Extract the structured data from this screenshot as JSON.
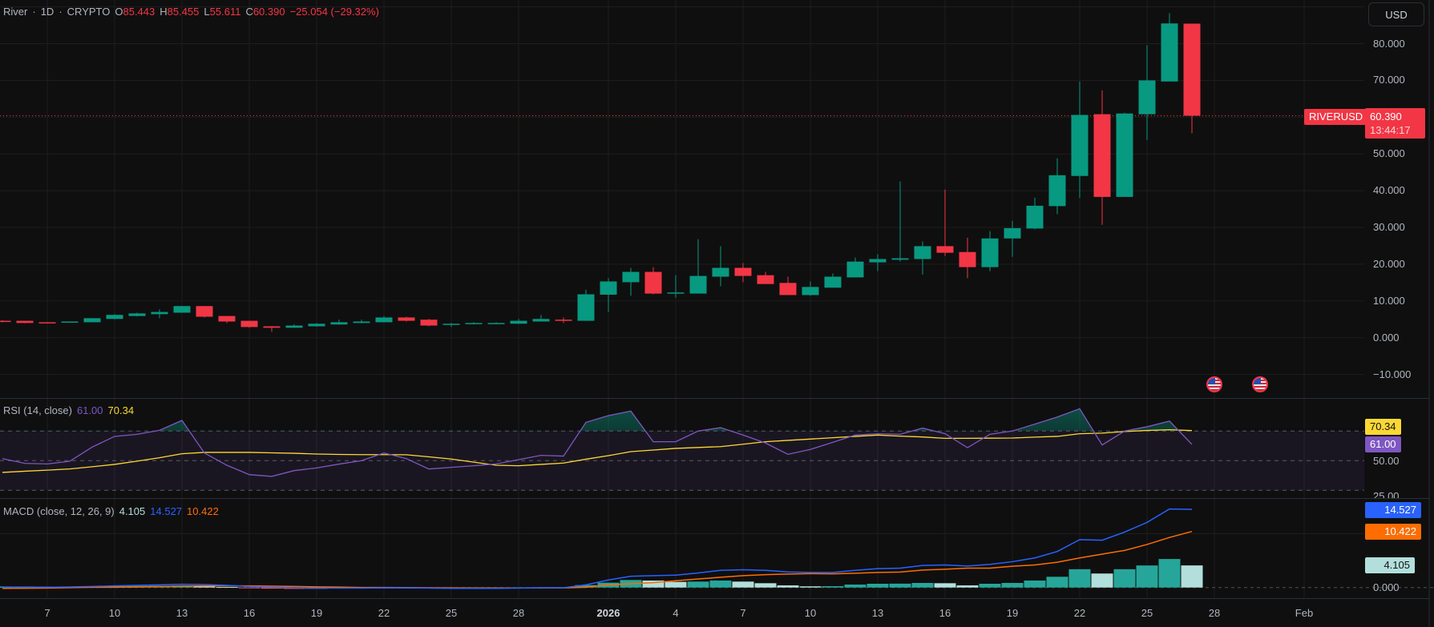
{
  "header": {
    "symbol": "River",
    "interval": "1D",
    "exchange": "CRYPTO",
    "sep": "·",
    "open_label": "O",
    "open": "85.443",
    "high_label": "H",
    "high": "85.455",
    "low_label": "L",
    "low": "55.611",
    "close_label": "C",
    "close": "60.390",
    "change": "−25.054 (−29.32%)"
  },
  "currency_button": "USD",
  "price_axis": [
    "80.000",
    "70.000",
    "50.000",
    "40.000",
    "30.000",
    "20.000",
    "10.000",
    "0.000",
    "−10.000"
  ],
  "last_price": {
    "symbol": "RIVERUSD",
    "price": "60.390",
    "countdown": "13:44:17"
  },
  "rsi": {
    "title": "RSI (14, close)",
    "value": "61.00",
    "ma_value": "70.34",
    "axis": [
      "50.00",
      "25.00"
    ]
  },
  "macd": {
    "title": "MACD (close, 12, 26, 9)",
    "hist_value": "4.105",
    "macd_value": "14.527",
    "signal_value": "10.422",
    "axis": [
      "0.000"
    ]
  },
  "x_axis": [
    "7",
    "10",
    "13",
    "16",
    "19",
    "22",
    "25",
    "28",
    "2026",
    "4",
    "7",
    "10",
    "13",
    "16",
    "19",
    "22",
    "25",
    "28",
    "Feb"
  ],
  "events": [
    "us-flag-event",
    "us-flag-event"
  ],
  "colors": {
    "up": "#089981",
    "down": "#f23645",
    "rsi": "#7e57c2",
    "rsi_ma": "#fdd835",
    "macd": "#2962ff",
    "signal": "#ff6d00",
    "hist_up_strong": "#26a69a",
    "hist_up_weak": "#b2dfdb",
    "hist_down_strong": "#ff5252",
    "hist_down_weak": "#ffcdd2",
    "background": "#0f0f0f"
  },
  "chart_data": {
    "type": "candlestick",
    "first_date": "Dec 5",
    "last_date": "Jan 27",
    "ohlc": [
      [
        4.6,
        4.8,
        4.2,
        4.4
      ],
      [
        4.6,
        4.6,
        3.9,
        4.0
      ],
      [
        4.2,
        4.2,
        4.0,
        4.0
      ],
      [
        4.2,
        4.4,
        4.2,
        4.4
      ],
      [
        4.2,
        5.3,
        4.2,
        5.3
      ],
      [
        5.1,
        6.4,
        5.0,
        6.2
      ],
      [
        5.9,
        6.8,
        5.8,
        6.6
      ],
      [
        6.4,
        7.7,
        5.3,
        7.0
      ],
      [
        6.8,
        8.6,
        6.8,
        8.6
      ],
      [
        8.6,
        8.6,
        5.5,
        5.7
      ],
      [
        5.9,
        5.9,
        4.0,
        4.4
      ],
      [
        4.6,
        4.6,
        2.7,
        2.9
      ],
      [
        3.1,
        3.1,
        1.6,
        2.7
      ],
      [
        2.7,
        3.6,
        2.7,
        3.3
      ],
      [
        3.1,
        4.0,
        3.0,
        3.8
      ],
      [
        3.6,
        4.9,
        3.5,
        4.2
      ],
      [
        4.0,
        4.9,
        3.9,
        4.4
      ],
      [
        4.2,
        5.9,
        4.2,
        5.5
      ],
      [
        5.5,
        5.7,
        4.4,
        4.6
      ],
      [
        4.9,
        5.1,
        3.1,
        3.3
      ],
      [
        3.6,
        4.0,
        2.9,
        3.8
      ],
      [
        3.8,
        4.2,
        3.6,
        4.0
      ],
      [
        3.8,
        4.2,
        3.7,
        4.0
      ],
      [
        3.8,
        5.1,
        3.8,
        4.6
      ],
      [
        4.4,
        6.2,
        4.4,
        5.1
      ],
      [
        4.9,
        5.5,
        4.0,
        4.7
      ],
      [
        4.6,
        13.1,
        4.6,
        11.8
      ],
      [
        11.7,
        16.2,
        7.0,
        15.3
      ],
      [
        15.1,
        19.0,
        11.4,
        17.9
      ],
      [
        17.9,
        19.2,
        11.8,
        12.0
      ],
      [
        12.1,
        17.0,
        10.9,
        12.3
      ],
      [
        12.0,
        26.8,
        12.0,
        16.8
      ],
      [
        16.6,
        24.9,
        14.0,
        19.0
      ],
      [
        19.0,
        20.3,
        15.1,
        16.8
      ],
      [
        17.0,
        17.9,
        14.6,
        14.6
      ],
      [
        14.9,
        16.6,
        11.6,
        11.6
      ],
      [
        11.6,
        15.3,
        11.4,
        13.8
      ],
      [
        13.6,
        17.5,
        13.6,
        16.6
      ],
      [
        16.4,
        21.8,
        16.4,
        20.7
      ],
      [
        20.5,
        22.7,
        18.1,
        21.4
      ],
      [
        21.2,
        42.5,
        20.7,
        21.6
      ],
      [
        21.4,
        26.2,
        17.2,
        24.9
      ],
      [
        24.9,
        40.3,
        22.2,
        23.1
      ],
      [
        23.3,
        27.2,
        16.2,
        19.2
      ],
      [
        19.2,
        29.0,
        18.1,
        27.0
      ],
      [
        27.0,
        31.8,
        22.0,
        29.8
      ],
      [
        29.7,
        38.1,
        29.5,
        35.9
      ],
      [
        35.8,
        48.8,
        33.6,
        44.2
      ],
      [
        44.0,
        69.7,
        38.0,
        60.6
      ],
      [
        60.8,
        67.3,
        30.7,
        38.3
      ],
      [
        38.3,
        61.2,
        38.3,
        61.0
      ],
      [
        60.8,
        79.6,
        53.8,
        70.0
      ],
      [
        69.7,
        88.3,
        69.7,
        85.5
      ],
      [
        85.443,
        85.455,
        55.611,
        60.39
      ]
    ],
    "price_range": [
      -15,
      92
    ],
    "rsi": [
      51.4,
      48.2,
      47.8,
      49.6,
      59.2,
      66.4,
      67.8,
      70.5,
      77.2,
      55.2,
      46.9,
      40.6,
      39.4,
      43.3,
      45.1,
      47.7,
      50.0,
      55.2,
      51.4,
      44.4,
      45.5,
      46.6,
      47.8,
      50.7,
      53.6,
      53.1,
      75.9,
      80.4,
      83.5,
      62.8,
      62.8,
      70.0,
      72.3,
      67.3,
      61.9,
      54.3,
      57.6,
      62.4,
      67.3,
      68.2,
      67.8,
      72.0,
      68.2,
      58.8,
      67.8,
      70.0,
      74.7,
      79.5,
      85.1,
      60.6,
      70.0,
      72.9,
      76.7,
      61.0
    ],
    "rsi_ma": [
      42.1,
      42.9,
      43.6,
      44.4,
      45.9,
      47.5,
      49.7,
      52.0,
      54.7,
      55.6,
      55.6,
      55.6,
      55.3,
      55.0,
      54.5,
      54.2,
      54.1,
      54.1,
      54.0,
      52.6,
      51.1,
      49.0,
      46.9,
      46.6,
      47.5,
      48.4,
      51.0,
      53.4,
      56.1,
      57.2,
      58.3,
      58.9,
      59.5,
      61.1,
      62.8,
      63.7,
      64.6,
      65.5,
      66.4,
      67.3,
      66.6,
      66.0,
      65.1,
      65.1,
      65.2,
      65.3,
      65.9,
      66.4,
      68.2,
      68.6,
      69.7,
      70.4,
      70.9,
      70.34
    ],
    "rsi_bands": [
      30,
      50,
      70
    ],
    "macd": [
      0.05,
      0.05,
      0.05,
      0.1,
      0.2,
      0.3,
      0.4,
      0.5,
      0.6,
      0.55,
      0.4,
      0.2,
      0.05,
      -0.05,
      -0.1,
      -0.1,
      -0.1,
      -0.05,
      -0.05,
      -0.1,
      -0.15,
      -0.15,
      -0.15,
      -0.1,
      -0.05,
      -0.05,
      0.5,
      1.4,
      2.1,
      2.2,
      2.3,
      2.7,
      3.2,
      3.3,
      3.2,
      2.9,
      2.8,
      2.8,
      3.2,
      3.5,
      3.6,
      4.1,
      4.2,
      4.0,
      4.3,
      4.8,
      5.5,
      6.7,
      8.9,
      8.8,
      10.3,
      12.1,
      14.6,
      14.527
    ],
    "histogram": [
      0.2,
      0.18,
      0.15,
      0.12,
      0.15,
      0.25,
      0.3,
      0.32,
      0.35,
      0.25,
      0.1,
      -0.1,
      -0.2,
      -0.25,
      -0.22,
      -0.18,
      -0.12,
      -0.06,
      -0.04,
      -0.06,
      -0.08,
      -0.07,
      -0.05,
      -0.02,
      0.02,
      0.02,
      0.45,
      0.9,
      1.4,
      1.3,
      1.05,
      1.1,
      1.3,
      1.1,
      0.8,
      0.4,
      0.22,
      0.25,
      0.55,
      0.7,
      0.72,
      0.85,
      0.8,
      0.4,
      0.7,
      0.85,
      1.3,
      2.0,
      3.4,
      2.6,
      3.4,
      4.1,
      5.3,
      4.105
    ]
  }
}
